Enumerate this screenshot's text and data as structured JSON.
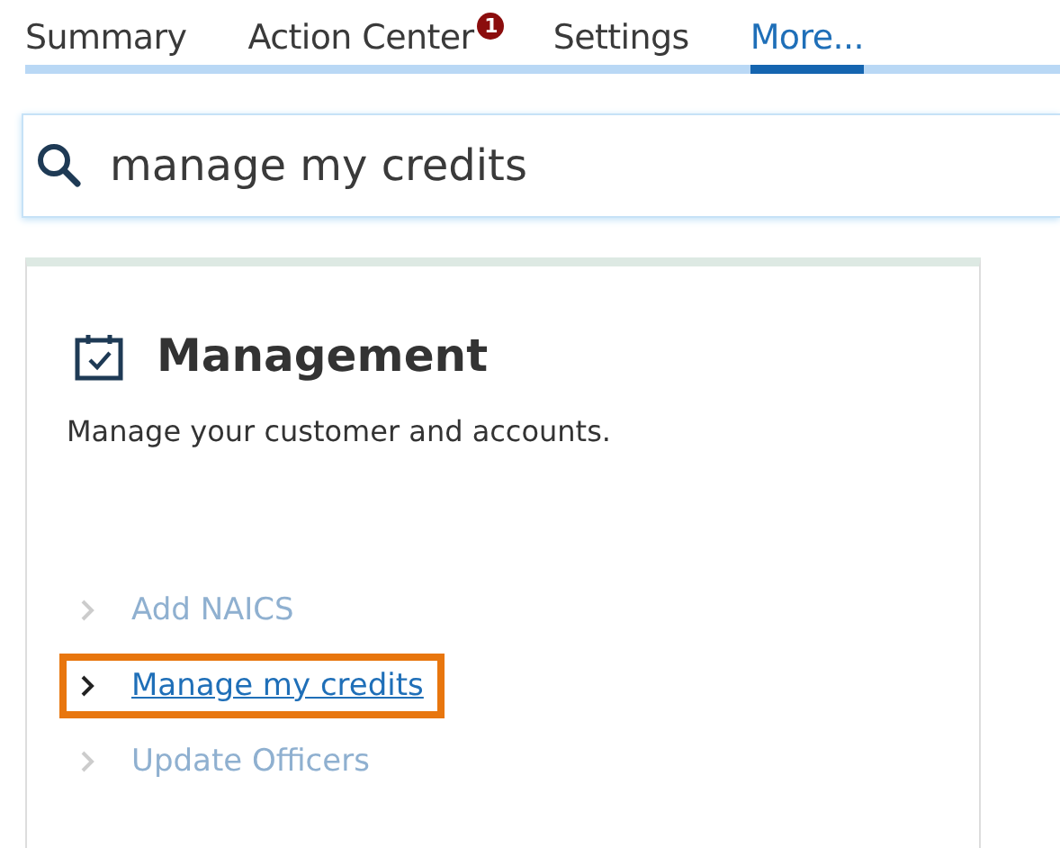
{
  "tabs": [
    {
      "label": "Summary",
      "selected": false
    },
    {
      "label": "Action Center",
      "selected": false,
      "badge": "1"
    },
    {
      "label": "Settings",
      "selected": false
    },
    {
      "label": "More...",
      "selected": true
    }
  ],
  "search": {
    "value": "manage my credits"
  },
  "card": {
    "title": "Management",
    "description": "Manage your customer and accounts.",
    "links": [
      {
        "label": "Add NAICS",
        "disabled": true,
        "highlighted": false
      },
      {
        "label": "Manage my credits",
        "disabled": false,
        "highlighted": true
      },
      {
        "label": "Update Officers",
        "disabled": true,
        "highlighted": false
      }
    ]
  }
}
